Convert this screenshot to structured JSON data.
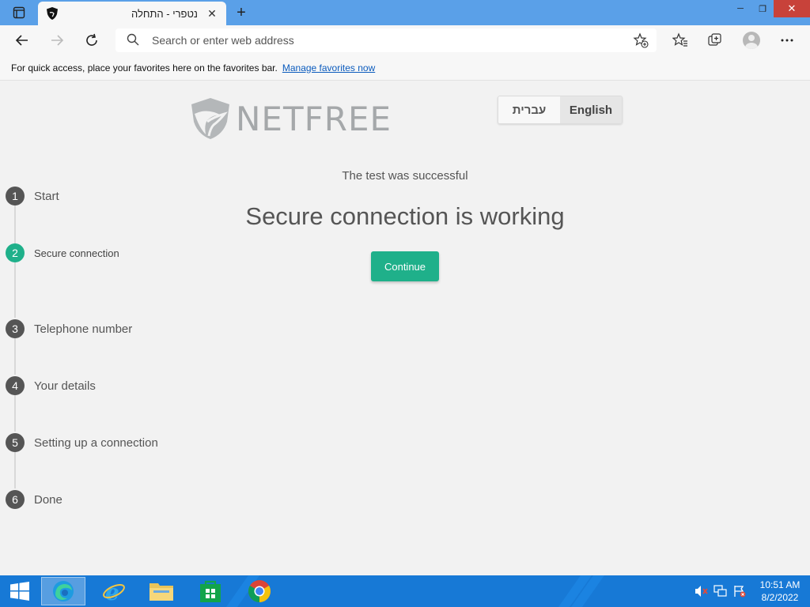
{
  "browser": {
    "tab_title": "נטפרי - התחלה",
    "address_placeholder": "Search or enter web address"
  },
  "favorites_bar": {
    "message": "For quick access, place your favorites here on the favorites bar.",
    "link_label": "Manage favorites now"
  },
  "page": {
    "logo_text": "NETFREE",
    "languages": [
      "עברית",
      "English"
    ],
    "selected_language": "English",
    "subtitle": "The test was successful",
    "headline": "Secure connection is working",
    "continue_label": "Continue"
  },
  "steps": [
    {
      "number": "1",
      "label": "Start"
    },
    {
      "number": "2",
      "label": "Secure connection",
      "active": true
    },
    {
      "number": "3",
      "label": "Telephone number"
    },
    {
      "number": "4",
      "label": "Your details"
    },
    {
      "number": "5",
      "label": "Setting up a connection"
    },
    {
      "number": "6",
      "label": "Done"
    }
  ],
  "taskbar": {
    "apps": [
      "edge",
      "internet-explorer",
      "file-explorer",
      "store",
      "chrome"
    ],
    "time": "10:51 AM",
    "date": "8/2/2022"
  },
  "colors": {
    "accent": "#1fb08a",
    "taskbar": "#1779d6",
    "titlebar": "#5aa0e8",
    "close_button": "#c8423a"
  }
}
